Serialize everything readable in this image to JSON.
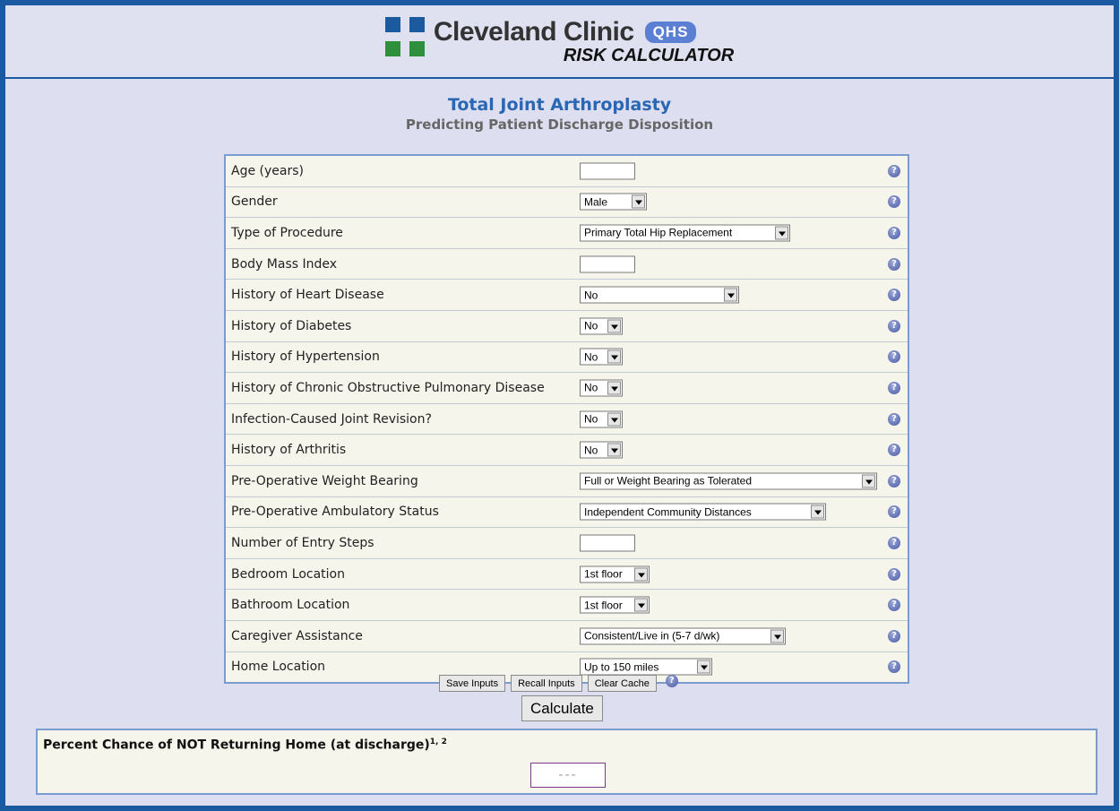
{
  "header": {
    "brand_name": "Cleveland Clinic",
    "brand_badge": "QHS",
    "brand_sub": "RISK CALCULATOR"
  },
  "page": {
    "title": "Total Joint Arthroplasty",
    "subtitle": "Predicting Patient Discharge Disposition"
  },
  "fields": [
    {
      "label": "Age (years)",
      "type": "text",
      "value": ""
    },
    {
      "label": "Gender",
      "type": "select",
      "value": "Male"
    },
    {
      "label": "Type of Procedure",
      "type": "select",
      "value": "Primary Total Hip Replacement"
    },
    {
      "label": "Body Mass Index",
      "type": "text",
      "value": ""
    },
    {
      "label": "History of Heart Disease",
      "type": "select",
      "value": "No"
    },
    {
      "label": "History of Diabetes",
      "type": "select",
      "value": "No"
    },
    {
      "label": "History of Hypertension",
      "type": "select",
      "value": "No"
    },
    {
      "label": "History of Chronic Obstructive Pulmonary Disease",
      "type": "select",
      "value": "No"
    },
    {
      "label": "Infection-Caused Joint Revision?",
      "type": "select",
      "value": "No"
    },
    {
      "label": "History of Arthritis",
      "type": "select",
      "value": "No"
    },
    {
      "label": "Pre-Operative Weight Bearing",
      "type": "select",
      "value": "Full or Weight Bearing as Tolerated"
    },
    {
      "label": "Pre-Operative Ambulatory Status",
      "type": "select",
      "value": "Independent Community Distances"
    },
    {
      "label": "Number of Entry Steps",
      "type": "text",
      "value": ""
    },
    {
      "label": "Bedroom Location",
      "type": "select",
      "value": "1st floor"
    },
    {
      "label": "Bathroom Location",
      "type": "select",
      "value": "1st floor"
    },
    {
      "label": "Caregiver Assistance",
      "type": "select",
      "value": "Consistent/Live in (5-7 d/wk)"
    },
    {
      "label": "Home Location",
      "type": "select",
      "value": "Up to 150 miles"
    }
  ],
  "help_glyph": "?",
  "buttons": {
    "save": "Save Inputs",
    "recall": "Recall Inputs",
    "clear": "Clear Cache",
    "calculate": "Calculate"
  },
  "result": {
    "label": "Percent Chance of NOT Returning Home (at discharge)",
    "footnote": "1, 2",
    "value": "---"
  },
  "colors": {
    "frame": "#1b5aa0",
    "title": "#2a67b2",
    "badge": "#5b7fd3"
  }
}
